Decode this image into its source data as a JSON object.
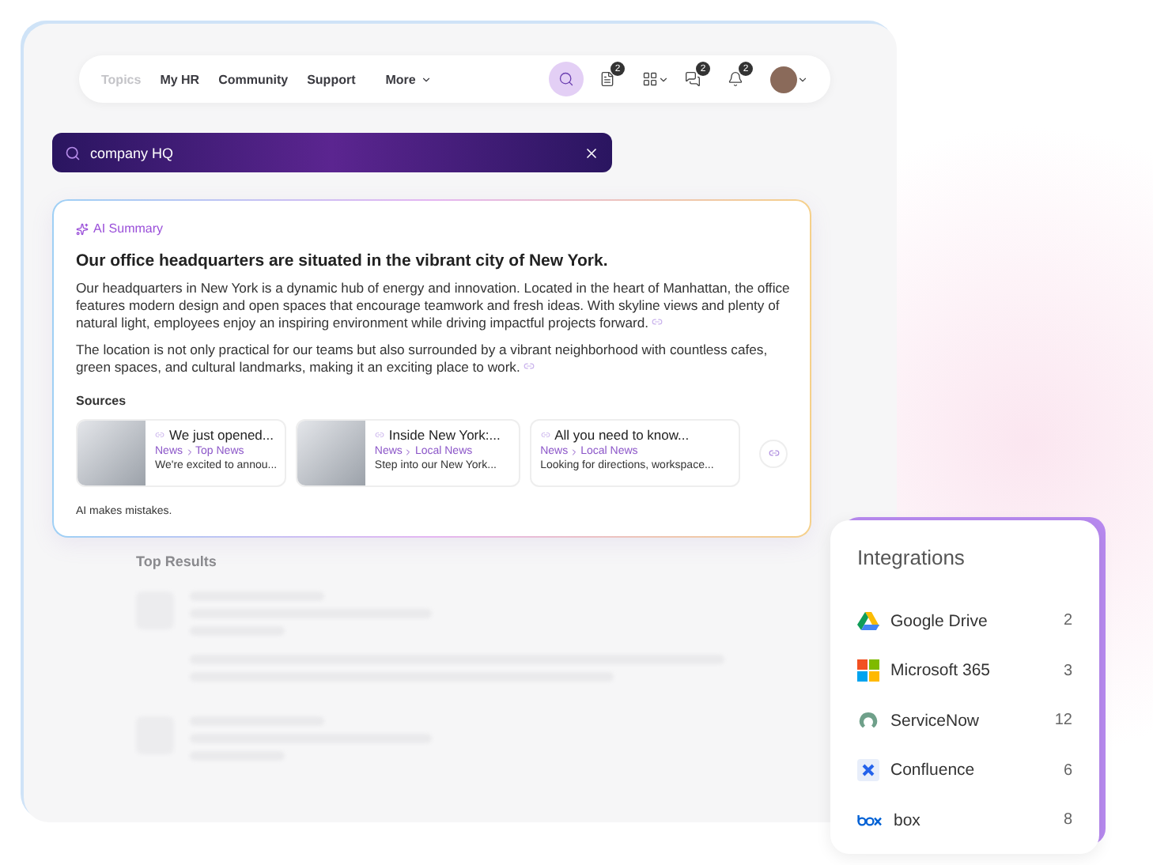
{
  "nav": {
    "items": [
      {
        "label": "Topics",
        "faded": true
      },
      {
        "label": "My HR",
        "faded": false
      },
      {
        "label": "Community",
        "faded": false
      },
      {
        "label": "Support",
        "faded": false
      },
      {
        "label": "More",
        "faded": false,
        "dropdown": true
      }
    ]
  },
  "toolbar": {
    "icons": [
      {
        "kind": "search",
        "active": true
      },
      {
        "kind": "document",
        "badge": "2"
      },
      {
        "kind": "apps",
        "dropdown": true
      },
      {
        "kind": "chat",
        "badge": "2"
      },
      {
        "kind": "bell",
        "badge": "2"
      },
      {
        "kind": "avatar",
        "dropdown": true
      }
    ]
  },
  "search": {
    "value": "company HQ"
  },
  "summary": {
    "label": "AI Summary",
    "headline": "Our office headquarters are situated in the vibrant city of New York.",
    "paragraphs": [
      "Our headquarters in New York is a dynamic hub of energy and innovation. Located in the heart of Manhattan, the office features modern design and open spaces that encourage teamwork and fresh ideas. With skyline views and plenty of natural light, employees enjoy an inspiring environment while driving impactful projects forward.",
      "The location is not only practical for our teams but also surrounded by a vibrant neighborhood with countless cafes, green spaces, and cultural landmarks, making it an exciting place to work."
    ],
    "sources_label": "Sources",
    "sources": [
      {
        "title": "We just opened...",
        "category": "News",
        "subcategory": "Top News",
        "snippet": "We're excited to annou...",
        "image": true
      },
      {
        "title": "Inside New York:...",
        "category": "News",
        "subcategory": "Local News",
        "snippet": "Step into our New York...",
        "image": true
      },
      {
        "title": "All you need to know...",
        "category": "News",
        "subcategory": "Local News",
        "snippet": "Looking for directions, workspace...",
        "image": false
      }
    ],
    "footer": "AI makes mistakes."
  },
  "top_results": {
    "title": "Top Results"
  },
  "integrations": {
    "title": "Integrations",
    "items": [
      {
        "kind": "drive",
        "name": "Google Drive",
        "count": "2"
      },
      {
        "kind": "microsoft",
        "name": "Microsoft 365",
        "count": "3"
      },
      {
        "kind": "servicenow",
        "name": "ServiceNow",
        "count": "12"
      },
      {
        "kind": "confluence",
        "name": "Confluence",
        "count": "6"
      },
      {
        "kind": "box",
        "name": "box",
        "count": "8"
      }
    ]
  }
}
